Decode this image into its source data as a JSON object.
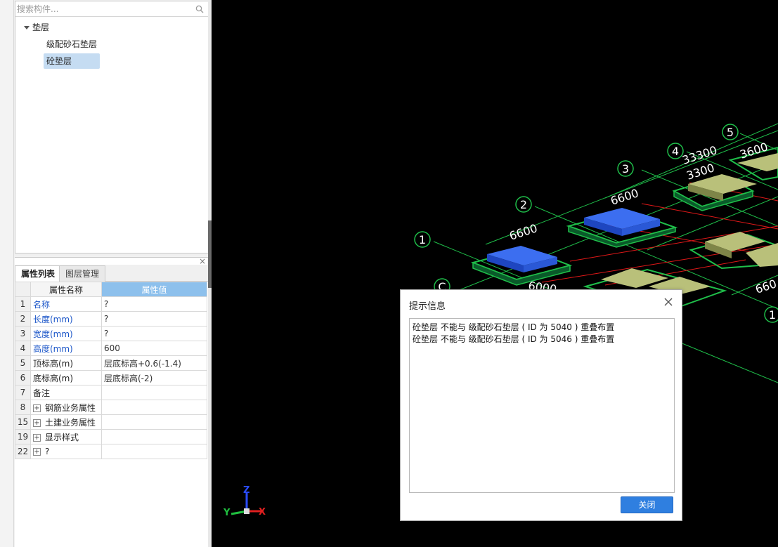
{
  "tree": {
    "search_placeholder": "搜索构件...",
    "root_label": "垫层",
    "items": [
      "级配砂石垫层",
      "砼垫层"
    ],
    "selected_index": 1
  },
  "props_panel": {
    "tabs": [
      "属性列表",
      "图层管理"
    ],
    "header": {
      "name": "属性名称",
      "value": "属性值"
    },
    "rows": [
      {
        "num": "1",
        "name": "名称",
        "value": "?",
        "name_color": "blue",
        "value_color": "grey"
      },
      {
        "num": "2",
        "name": "长度(mm)",
        "value": "?",
        "name_color": "blue",
        "value_color": "grey"
      },
      {
        "num": "3",
        "name": "宽度(mm)",
        "value": "?",
        "name_color": "blue",
        "value_color": "grey"
      },
      {
        "num": "4",
        "name": "高度(mm)",
        "value": "600",
        "name_color": "blue",
        "value_color": "grey"
      },
      {
        "num": "5",
        "name": "顶标高(m)",
        "value": "层底标高+0.6(-1.4)",
        "name_color": "",
        "value_color": ""
      },
      {
        "num": "6",
        "name": "底标高(m)",
        "value": "层底标高(-2)",
        "name_color": "",
        "value_color": ""
      },
      {
        "num": "7",
        "name": "备注",
        "value": "",
        "name_color": "",
        "value_color": ""
      },
      {
        "num": "8",
        "name": "钢筋业务属性",
        "value": "",
        "expand": true
      },
      {
        "num": "15",
        "name": "土建业务属性",
        "value": "",
        "expand": true
      },
      {
        "num": "19",
        "name": "显示样式",
        "value": "",
        "expand": true
      },
      {
        "num": "22",
        "name": "?",
        "value": "",
        "expand": true
      }
    ]
  },
  "viewport": {
    "axis_labels": {
      "x": "X",
      "y": "Y",
      "z": "Z"
    },
    "axis_bubbles": [
      "1",
      "2",
      "3",
      "4",
      "5",
      "C",
      "1"
    ],
    "dimension_labels": [
      "6600",
      "6600",
      "33300",
      "3300",
      "3600",
      "6000",
      "660"
    ],
    "colors": {
      "grid": "#1fbf4a",
      "selected_pad": "#2453d8",
      "pad": "#a9b06a",
      "red_line": "#e01818"
    }
  },
  "dialog": {
    "title": "提示信息",
    "messages": [
      "砼垫层 不能与 级配砂石垫层 ( ID 为 5040 ) 重叠布置",
      "砼垫层 不能与 级配砂石垫层 ( ID 为 5046 ) 重叠布置"
    ],
    "close_button_label": "关闭"
  }
}
